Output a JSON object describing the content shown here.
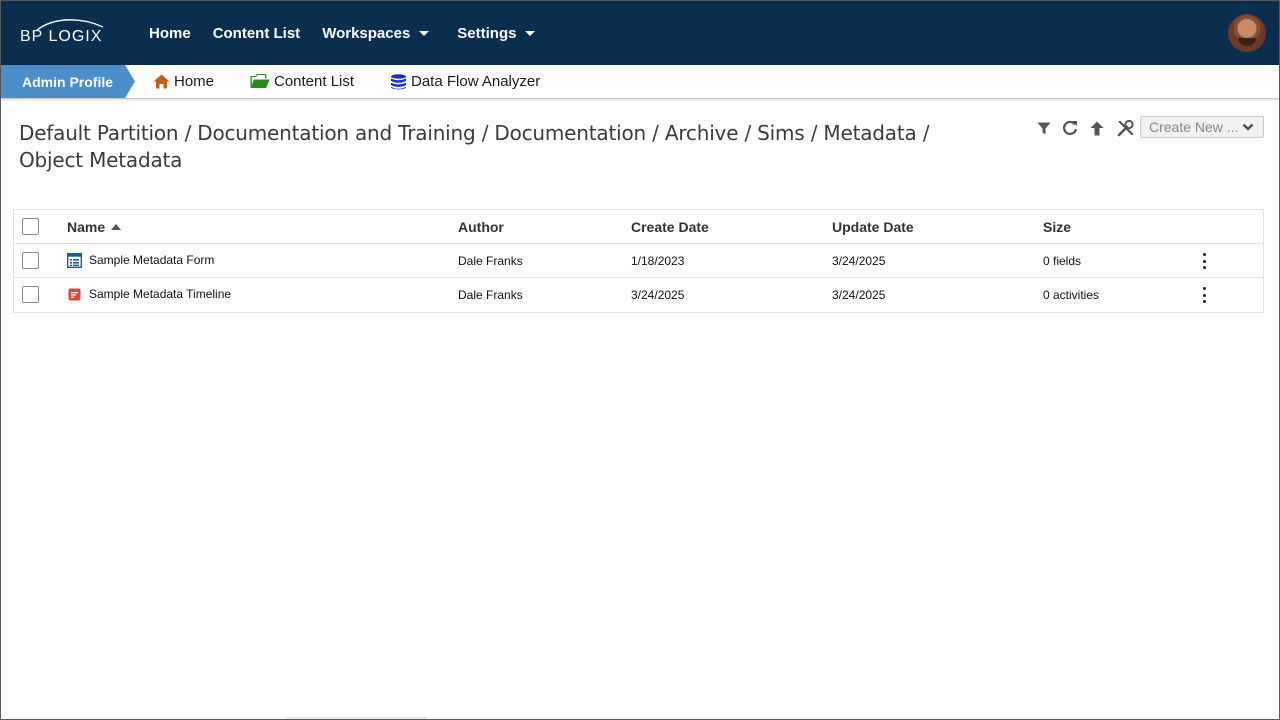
{
  "brand": {
    "logo_text": "BP LOGIX"
  },
  "topnav": {
    "items": [
      {
        "label": "Home"
      },
      {
        "label": "Content List"
      },
      {
        "label": "Workspaces",
        "has_dropdown": true
      },
      {
        "label": "Settings",
        "has_dropdown": true
      }
    ]
  },
  "subnav": {
    "profile_tab": "Admin Profile",
    "links": [
      {
        "label": "Home",
        "icon": "home-icon",
        "color": "#c0601a"
      },
      {
        "label": "Content List",
        "icon": "folder-open-icon",
        "color": "#2a8a1e"
      },
      {
        "label": "Data Flow Analyzer",
        "icon": "database-icon",
        "color": "#1a2fc8"
      }
    ]
  },
  "path": {
    "segments": [
      "Default Partition",
      "Documentation and Training",
      "Documentation",
      "Archive",
      "Sims",
      "Metadata",
      "Object Metadata"
    ],
    "separator": "/"
  },
  "toolbar": {
    "icons": [
      "filter-icon",
      "refresh-icon",
      "arrow-up-icon",
      "tools-icon"
    ],
    "create_new_label": "Create New ..."
  },
  "table": {
    "columns": {
      "name": "Name",
      "author": "Author",
      "create_date": "Create Date",
      "update_date": "Update Date",
      "size": "Size"
    },
    "sort": {
      "column": "name",
      "direction": "ascending"
    },
    "rows": [
      {
        "name": "Sample Metadata Form",
        "icon": "form-icon",
        "author": "Dale Franks",
        "create_date": "1/18/2023",
        "update_date": "3/24/2025",
        "size": "0 fields"
      },
      {
        "name": "Sample Metadata Timeline",
        "icon": "timeline-icon",
        "author": "Dale Franks",
        "create_date": "3/24/2025",
        "update_date": "3/24/2025",
        "size": "0 activities"
      }
    ]
  },
  "colors": {
    "topbar": "#0b2d4e",
    "profile_tab": "#4b8ec8",
    "form_icon": "#1d5f86",
    "timeline_icon": "#d94a3a"
  }
}
